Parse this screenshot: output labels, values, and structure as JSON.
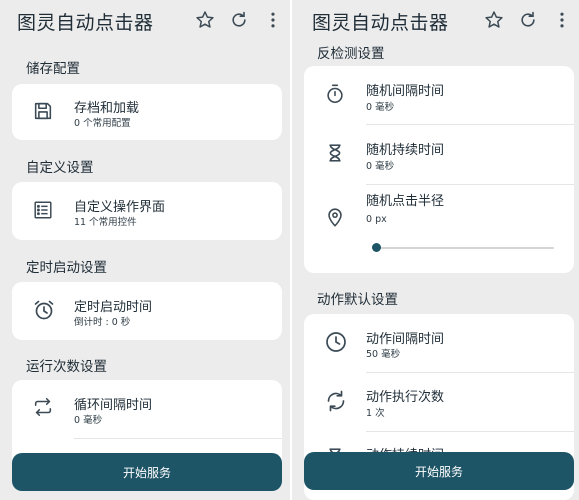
{
  "app": {
    "title": "图灵自动点击器",
    "icons": [
      "star-icon",
      "refresh-icon",
      "more-vert-icon"
    ]
  },
  "left": {
    "sections": [
      {
        "title": "储存配置",
        "items": [
          {
            "icon": "save-icon",
            "title": "存档和加载",
            "subtitle": "0 个常用配置"
          }
        ]
      },
      {
        "title": "自定义设置",
        "items": [
          {
            "icon": "list-icon",
            "title": "自定义操作界面",
            "subtitle": "11 个常用控件"
          }
        ]
      },
      {
        "title": "定时启动设置",
        "items": [
          {
            "icon": "alarm-icon",
            "title": "定时启动时间",
            "subtitle": "倒计时 : 0 秒"
          }
        ]
      },
      {
        "title": "运行次数设置",
        "items": [
          {
            "icon": "repeat-icon",
            "title": "循环间隔时间",
            "subtitle": "0 毫秒"
          }
        ]
      }
    ],
    "start_button": "开始服务"
  },
  "right": {
    "sections": [
      {
        "title": "反检测设置",
        "items": [
          {
            "icon": "timer-icon",
            "title": "随机间隔时间",
            "subtitle": "0 毫秒"
          },
          {
            "icon": "hourglass-icon",
            "title": "随机持续时间",
            "subtitle": "0 毫秒"
          },
          {
            "icon": "location-pin-icon",
            "title": "随机点击半径",
            "subtitle": "0 px",
            "slider_value": 0
          }
        ]
      },
      {
        "title": "动作默认设置",
        "items": [
          {
            "icon": "clock-icon",
            "title": "动作间隔时间",
            "subtitle": "50 毫秒"
          },
          {
            "icon": "sync-icon",
            "title": "动作执行次数",
            "subtitle": "1 次"
          },
          {
            "icon": "hourglass-icon",
            "title": "动作持续时间",
            "subtitle": ""
          }
        ]
      }
    ],
    "start_button": "开始服务"
  },
  "colors": {
    "accent": "#1d5466",
    "background": "#ececec",
    "card": "#ffffff",
    "text": "#1f2d37"
  }
}
